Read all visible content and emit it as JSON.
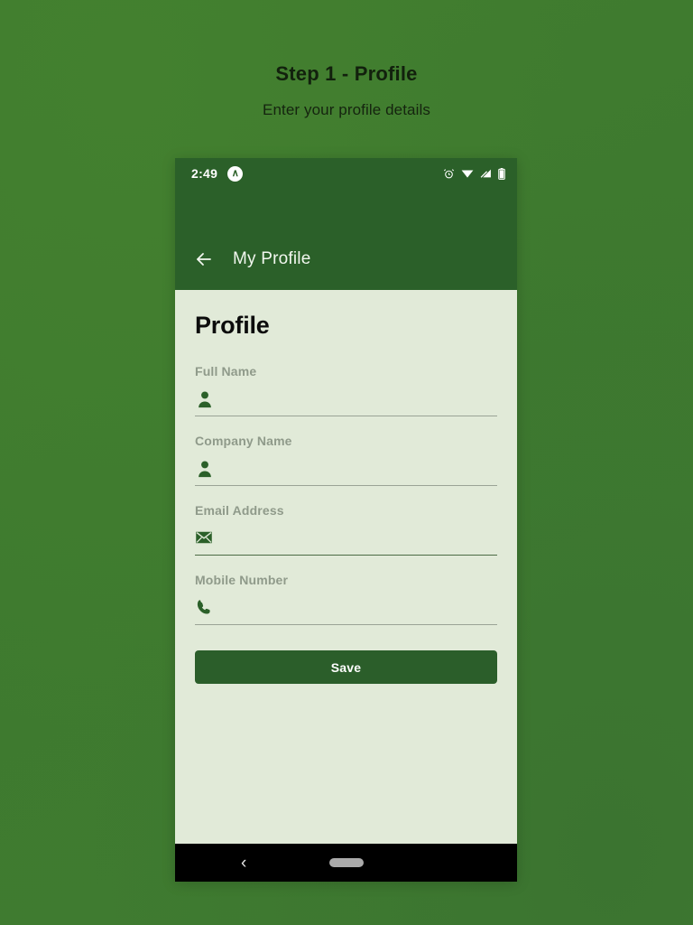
{
  "page": {
    "step_title": "Step 1 - Profile",
    "step_subtitle": "Enter your profile details",
    "background_color": "#3e7a2f",
    "title_color": "#12210d"
  },
  "phone": {
    "status_bar": {
      "time": "2:49",
      "badge_glyph": "∧",
      "icons": [
        "alarm-icon",
        "wifi-icon",
        "signal-icon",
        "battery-icon"
      ],
      "background_color": "#2b6029",
      "foreground_color": "#ffffff"
    },
    "app_bar": {
      "back_icon": "arrow-left-icon",
      "title": "My Profile",
      "background_color": "#2b6029",
      "title_color": "#f2f7ef"
    },
    "screen": {
      "background_color": "#e1ead8",
      "heading": "Profile",
      "heading_color": "#0c0c0c",
      "label_color": "#8f9a8a",
      "icon_color": "#2b6029",
      "fields": [
        {
          "label": "Full Name",
          "icon": "person-icon",
          "value": "",
          "placeholder": "",
          "focused": false
        },
        {
          "label": "Company Name",
          "icon": "person-icon",
          "value": "",
          "placeholder": "",
          "focused": false
        },
        {
          "label": "Email Address",
          "icon": "envelope-icon",
          "value": "",
          "placeholder": "",
          "focused": true
        },
        {
          "label": "Mobile Number",
          "icon": "phone-icon",
          "value": "",
          "placeholder": "",
          "focused": false
        }
      ],
      "save_label": "Save",
      "save_color": "#2b5e2a"
    },
    "nav_bar": {
      "back_glyph": "‹",
      "home_indicator": "home-pill",
      "background_color": "#000000"
    }
  }
}
